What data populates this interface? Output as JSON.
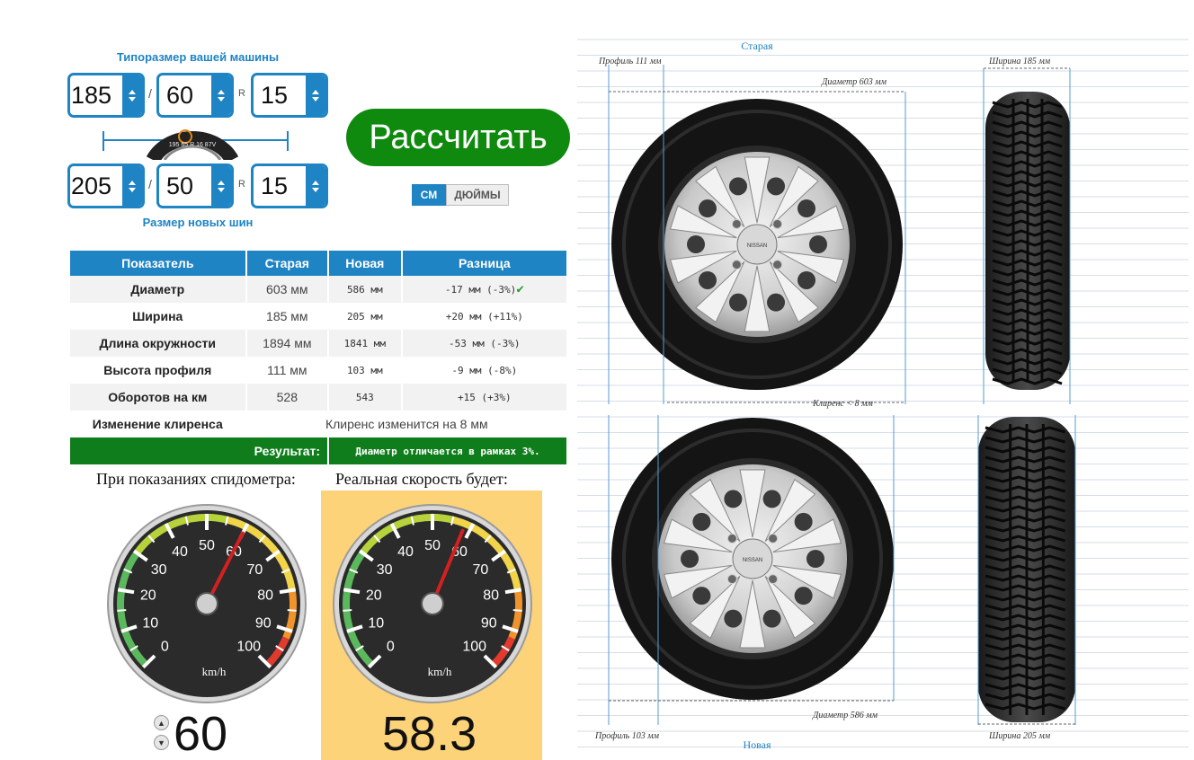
{
  "sizes": {
    "current_label": "Типоразмер вашей машины",
    "new_label": "Размер новых шин",
    "current": {
      "width": "185",
      "profile": "60",
      "radius": "15"
    },
    "new": {
      "width": "205",
      "profile": "50",
      "radius": "15"
    },
    "slash": "/",
    "r": "R",
    "badge_text": "195 65 R 16 87V"
  },
  "actions": {
    "calculate": "Рассчитать",
    "unit_cm": "СМ",
    "unit_inch": "ДЮЙМЫ"
  },
  "table": {
    "headers": [
      "Показатель",
      "Старая",
      "Новая",
      "Разница"
    ],
    "rows": [
      {
        "label": "Диаметр",
        "old": "603 мм",
        "new": "586 мм",
        "diff": "-17 мм (-3%)",
        "check": "✔"
      },
      {
        "label": "Ширина",
        "old": "185 мм",
        "new": "205 мм",
        "diff": "+20 мм (+11%)"
      },
      {
        "label": "Длина окружности",
        "old": "1894 мм",
        "new": "1841 мм",
        "diff": "-53 мм (-3%)"
      },
      {
        "label": "Высота профиля",
        "old": "111 мм",
        "new": "103 мм",
        "diff": "-9 мм (-8%)"
      },
      {
        "label": "Оборотов на км",
        "old": "528",
        "new": "543",
        "diff": "+15 (+3%)"
      }
    ],
    "clearance": {
      "label": "Изменение клиренса",
      "value": "Клиренс изменится на 8 мм"
    },
    "result": {
      "label": "Результат:",
      "value": "Диаметр отличается в рамках 3%."
    }
  },
  "speed": {
    "input_label": "При показаниях спидометра:",
    "output_label": "Реальная скорость будет:",
    "input_value": "60",
    "output_value": "58.3",
    "up": "▲",
    "down": "▼",
    "gauge_ticks": [
      "0",
      "10",
      "20",
      "30",
      "40",
      "50",
      "60",
      "70",
      "80",
      "90",
      "100"
    ],
    "unit": "km/h"
  },
  "diagram": {
    "old_title": "Старая",
    "new_title": "Новая",
    "old_profile": "Профиль 111 мм",
    "old_width": "Ширина 185 мм",
    "old_diameter": "Диаметр 603 мм",
    "clearance": "Клиренс < 8 мм",
    "new_diameter": "Диаметр 586 мм",
    "new_profile": "Профиль 103 мм",
    "new_width": "Ширина 205 мм",
    "hub_text": "NISSAN"
  }
}
